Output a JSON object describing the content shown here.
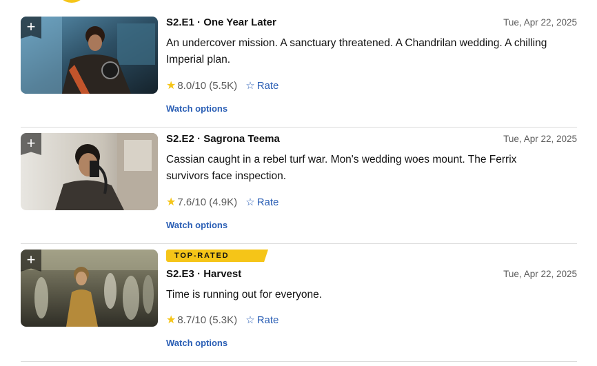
{
  "episodes": [
    {
      "title": "S2.E1 · One Year Later",
      "date": "Tue, Apr 22, 2025",
      "description": "An undercover mission. A sanctuary threatened. A Chandrilan wedding. A chilling Imperial plan.",
      "rating": "8.0/10",
      "votes": "(5.5K)",
      "rate_label": "Rate",
      "watch_label": "Watch options",
      "add_icon": "+"
    },
    {
      "title": "S2.E2 · Sagrona Teema",
      "date": "Tue, Apr 22, 2025",
      "description": "Cassian caught in a rebel turf war. Mon's wedding woes mount. The Ferrix survivors face inspection.",
      "rating": "7.6/10",
      "votes": "(4.9K)",
      "rate_label": "Rate",
      "watch_label": "Watch options",
      "add_icon": "+"
    },
    {
      "badge": "TOP-RATED",
      "title": "S2.E3 · Harvest",
      "date": "Tue, Apr 22, 2025",
      "description": "Time is running out for everyone.",
      "rating": "8.7/10",
      "votes": "(5.3K)",
      "rate_label": "Rate",
      "watch_label": "Watch options",
      "add_icon": "+"
    }
  ],
  "colors": {
    "accent": "#f5c518",
    "link": "#2b5fb5",
    "muted": "#5c5c5c"
  },
  "icons": {
    "add": "plus-icon",
    "star": "star-filled-icon",
    "rate": "star-outline-icon"
  }
}
